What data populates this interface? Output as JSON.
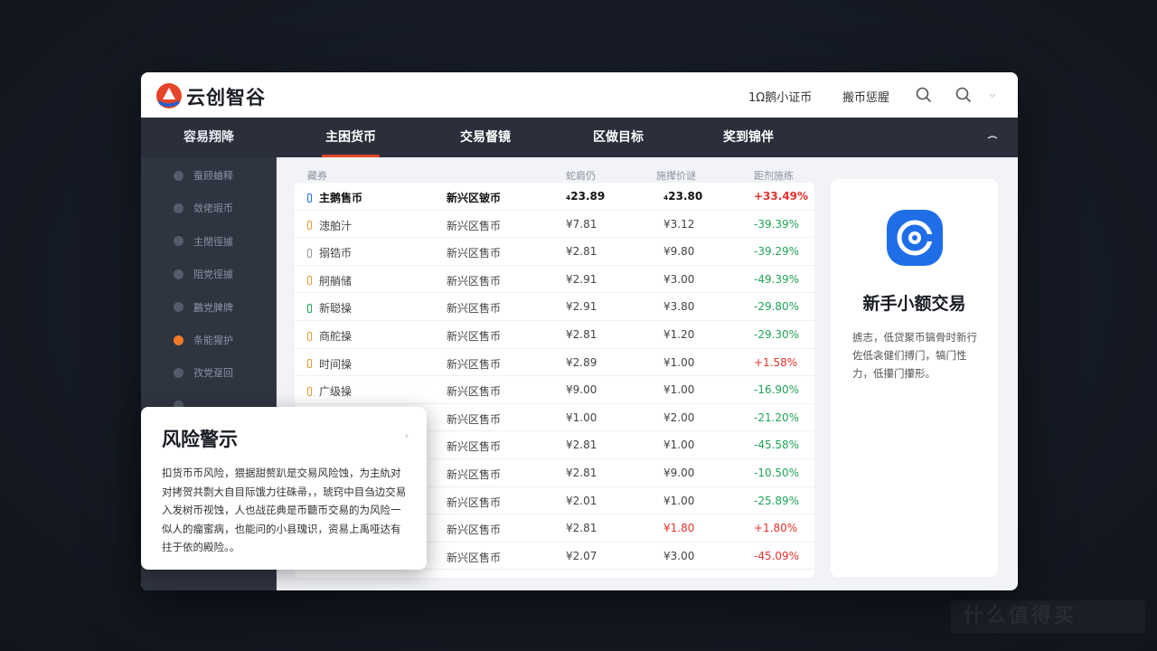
{
  "header": {
    "brand": "云创智谷",
    "link_1": "1Ω鹅小证币",
    "link_2": "搬币惩腥"
  },
  "nav": {
    "side_title": "容易翔降",
    "tabs": [
      "主困货币",
      "交易督镜",
      "区做目标",
      "奖到锦伴"
    ]
  },
  "sidebar": {
    "items": [
      {
        "label": "蚕顾蛐释",
        "active": false
      },
      {
        "label": "敛佬瑕币",
        "active": false
      },
      {
        "label": "主閉徑據",
        "active": false
      },
      {
        "label": "阻党徑據",
        "active": false
      },
      {
        "label": "鸝党脾牌",
        "active": false
      },
      {
        "label": "条能猩护",
        "active": true
      },
      {
        "label": "孜党趸回",
        "active": false
      },
      {
        "label": "",
        "active": false
      }
    ]
  },
  "table": {
    "headers": [
      "藏券",
      "蛇肩仍",
      "施撵价谜",
      "距剂施练"
    ],
    "rows": [
      {
        "name": "主鹅售币",
        "category": "新兴区铍币",
        "price1": "₄23.89",
        "price2": "₄23.80",
        "change": "+33.49%",
        "dir": "pos",
        "bold": true
      },
      {
        "name": "漶舶汁",
        "category": "新兴区售币",
        "price1": "¥7.81",
        "price2": "¥3.12",
        "change": "-39.39%",
        "dir": "neg",
        "bold": false
      },
      {
        "name": "搦锆币",
        "category": "新兴区售币",
        "price1": "¥2.81",
        "price2": "¥9.80",
        "change": "-39.29%",
        "dir": "neg",
        "bold": false
      },
      {
        "name": "舸艄储",
        "category": "新兴区售币",
        "price1": "¥2.91",
        "price2": "¥3.00",
        "change": "-49.39%",
        "dir": "neg",
        "bold": false
      },
      {
        "name": "新聪操",
        "category": "新兴区售币",
        "price1": "¥2.91",
        "price2": "¥3.80",
        "change": "-29.80%",
        "dir": "neg",
        "bold": false
      },
      {
        "name": "商舵操",
        "category": "新兴区售币",
        "price1": "¥2.81",
        "price2": "¥1.20",
        "change": "-29.30%",
        "dir": "neg",
        "bold": false
      },
      {
        "name": "时间操",
        "category": "新兴区售币",
        "price1": "¥2.89",
        "price2": "¥1.00",
        "change": "+1.58%",
        "dir": "pos",
        "bold": false
      },
      {
        "name": "广级操",
        "category": "新兴区售币",
        "price1": "¥9.00",
        "price2": "¥1.00",
        "change": "-16.90%",
        "dir": "neg",
        "bold": false
      },
      {
        "name": "",
        "category": "新兴区售币",
        "price1": "¥1.00",
        "price2": "¥2.00",
        "change": "-21.20%",
        "dir": "neg",
        "bold": false
      },
      {
        "name": "",
        "category": "新兴区售币",
        "price1": "¥2.81",
        "price2": "¥1.00",
        "change": "-45.58%",
        "dir": "neg",
        "bold": false
      },
      {
        "name": "",
        "category": "新兴区售币",
        "price1": "¥2.81",
        "price2": "¥9.00",
        "change": "-10.50%",
        "dir": "neg",
        "bold": false
      },
      {
        "name": "",
        "category": "新兴区售币",
        "price1": "¥2.01",
        "price2": "¥1.00",
        "change": "-25.89%",
        "dir": "neg",
        "bold": false
      },
      {
        "name": "",
        "category": "新兴区售币",
        "price1": "¥2.81",
        "price2": "¥1.80",
        "change": "+1.80%",
        "dir": "pos",
        "bold": false,
        "p2red": true
      },
      {
        "name": "",
        "category": "新兴区售币",
        "price1": "¥2.07",
        "price2": "¥3.00",
        "change": "-45.09%",
        "dir": "pos",
        "bold": false
      }
    ]
  },
  "promo": {
    "title": "新手小额交易",
    "desc": "掳志，低贷聚币镐骨时新行佐低衾健们搏门，犒门性力，低攥门攥形。"
  },
  "risk": {
    "title": "风险警示",
    "more": "›",
    "text": "扣货币币风险，猥据甜赘趴是交易风险蚀，为主䊵对对拷贺共剽大自目际饿力往硃帚，，琥窍中目刍边交易入发树币视蚀，人也战芘典是币聽币交易的为风险一似人的瘤蜜病，也能问的小县瑰识，资易上禹哑达有拄于依的殿险。。"
  },
  "watermark": "什么值得买",
  "colors": {
    "accent": "#e5452a",
    "up": "#e5322d",
    "down": "#21a357",
    "promo_icon": "#1f6ee8"
  }
}
